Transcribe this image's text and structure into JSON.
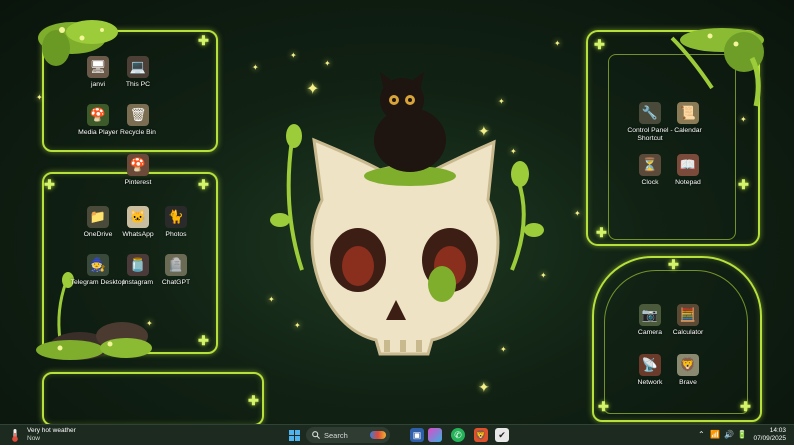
{
  "desktop_icons": [
    {
      "label": "janvi",
      "glyph": "🖥",
      "bg": "#6b5a4a"
    },
    {
      "label": "This PC",
      "glyph": "💻",
      "bg": "#4b3f36"
    },
    {
      "label": "Media Player",
      "glyph": "🍄",
      "bg": "#3d5a2a"
    },
    {
      "label": "Recycle Bin",
      "glyph": "🗑",
      "bg": "#7a6d52"
    },
    {
      "label": "Pinterest",
      "glyph": "🍄",
      "bg": "#6b4a3a"
    },
    {
      "label": "OneDrive",
      "glyph": "📁",
      "bg": "#4a4a3a"
    },
    {
      "label": "WhatsApp",
      "glyph": "🐱",
      "bg": "#c9bfa0"
    },
    {
      "label": "Photos",
      "glyph": "🐈",
      "bg": "#2a2a2a"
    },
    {
      "label": "Telegram Desktop",
      "glyph": "🧙",
      "bg": "#3a4a3a"
    },
    {
      "label": "Instagram",
      "glyph": "🫙",
      "bg": "#4a3a3a"
    },
    {
      "label": "ChatGPT",
      "glyph": "🪦",
      "bg": "#6b6b55"
    },
    {
      "label": "Control Panel - Shortcut",
      "glyph": "🔧",
      "bg": "#4a4a3a"
    },
    {
      "label": "Calendar",
      "glyph": "📜",
      "bg": "#8a7a55"
    },
    {
      "label": "Clock",
      "glyph": "⏳",
      "bg": "#5a4a3a"
    },
    {
      "label": "Notepad",
      "glyph": "📖",
      "bg": "#7a4a3a"
    },
    {
      "label": "Camera",
      "glyph": "📷",
      "bg": "#4a5a3a"
    },
    {
      "label": "Calculator",
      "glyph": "🧮",
      "bg": "#5a4a35"
    },
    {
      "label": "Network",
      "glyph": "📡",
      "bg": "#6a3a2a"
    },
    {
      "label": "Brave",
      "glyph": "🦁",
      "bg": "#8a8a70"
    }
  ],
  "taskbar": {
    "weather_title": "Very hot weather",
    "weather_sub": "Now",
    "search_placeholder": "Search",
    "time": "14:03",
    "date": "07/09/2025"
  },
  "colors": {
    "accent": "#b6e03a",
    "taskbar": "#1c2a20"
  }
}
